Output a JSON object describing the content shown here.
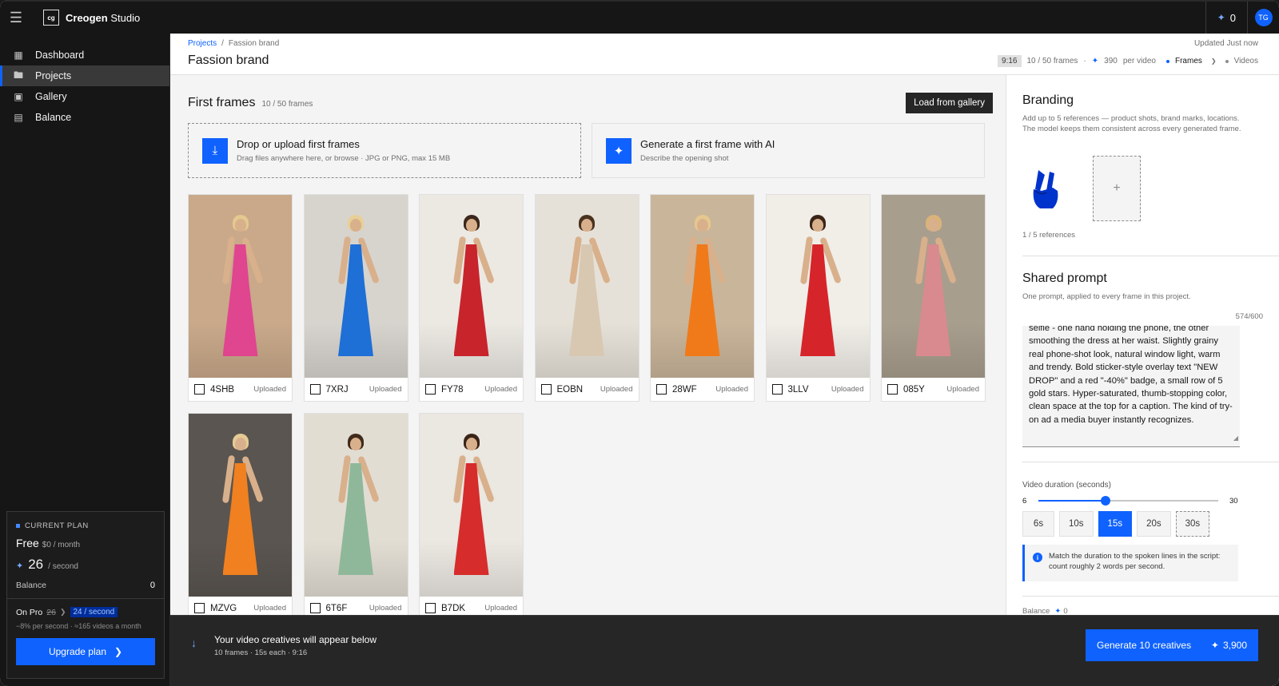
{
  "app": {
    "logo_text": "cg",
    "name_bold": "Creogen",
    "name_rest": "Studio",
    "credits": "0",
    "avatar_initials": "TG"
  },
  "sidebar": {
    "items": [
      {
        "label": "Dashboard",
        "icon": "grid-icon"
      },
      {
        "label": "Projects",
        "icon": "folder-icon",
        "active": true
      },
      {
        "label": "Gallery",
        "icon": "image-icon"
      },
      {
        "label": "Balance",
        "icon": "wallet-icon"
      }
    ],
    "plan": {
      "tag": "CURRENT PLAN",
      "name": "Free",
      "price": "$0 / month",
      "rate_value": "26",
      "rate_unit": "/ second",
      "balance_label": "Balance",
      "balance_value": "0",
      "pro_label": "On Pro",
      "pro_old": "26",
      "pro_new": "24 / second",
      "pro_sub": "−8% per second · ≈165 videos a month",
      "upgrade_label": "Upgrade plan"
    }
  },
  "header": {
    "crumb_root": "Projects",
    "crumb_sep": "/",
    "crumb_current": "Fassion brand",
    "title": "Fassion brand",
    "updated": "Updated Just now",
    "ratio": "9:16",
    "frames": "10 / 50 frames",
    "per_video_value": "390",
    "per_video_label": "per video",
    "step_frames": "Frames",
    "step_videos": "Videos"
  },
  "first_frames": {
    "title": "First frames",
    "count": "10 / 50 frames",
    "load_label": "Load from gallery",
    "upload_title": "Drop or upload first frames",
    "upload_sub": "Drag files anywhere here, or browse · JPG or PNG, max 15 MB",
    "ai_title": "Generate a first frame with AI",
    "ai_sub": "Describe the opening shot",
    "status": "Uploaded",
    "tiles": [
      {
        "id": "4SHB",
        "bg": "#c9a98a",
        "dress": "#e0458f",
        "hair": "#e3c98f"
      },
      {
        "id": "7XRJ",
        "bg": "#d7d4ce",
        "dress": "#1e6fd6",
        "hair": "#e8cf95"
      },
      {
        "id": "FY78",
        "bg": "#ece9e3",
        "dress": "#c8242c",
        "hair": "#3b271b"
      },
      {
        "id": "EOBN",
        "bg": "#e6e1d8",
        "dress": "#d8c8b2",
        "hair": "#4a3220"
      },
      {
        "id": "28WF",
        "bg": "#c9b59a",
        "dress": "#f07a1a",
        "hair": "#e6c88e"
      },
      {
        "id": "3LLV",
        "bg": "#f1eee8",
        "dress": "#d6252a",
        "hair": "#3a2418"
      },
      {
        "id": "085Y",
        "bg": "#a89e8e",
        "dress": "#d98a8f",
        "hair": "#d9b379"
      },
      {
        "id": "MZVG",
        "bg": "#5a5550",
        "dress": "#f08020",
        "hair": "#e6cb95"
      },
      {
        "id": "6T6F",
        "bg": "#e2ddd3",
        "dress": "#8fb89a",
        "hair": "#3f2a1c"
      },
      {
        "id": "B7DK",
        "bg": "#ebe7e1",
        "dress": "#d62c2c",
        "hair": "#3a2418"
      }
    ]
  },
  "branding": {
    "title": "Branding",
    "desc": "Add up to 5 references — product shots, brand marks, locations. The model keeps them consistent across every generated frame.",
    "ref_count": "1 / 5 references",
    "add_symbol": "+"
  },
  "shared_prompt": {
    "title": "Shared prompt",
    "desc": "One prompt, applied to every frame in this project.",
    "counter": "574/600",
    "text": "selfie - one hand holding the phone, the other smoothing the dress at her waist. Slightly grainy real phone-shot look, natural window light, warm and trendy. Bold sticker-style overlay text \"NEW DROP\" and a red \"-40%\" badge, a small row of 5 gold stars. Hyper-saturated, thumb-stopping color, clean space at the top for a caption. The kind of try-on ad a media buyer instantly recognizes."
  },
  "duration": {
    "label": "Video duration (seconds)",
    "min": "6",
    "max": "30",
    "value": 15,
    "options": [
      "6s",
      "10s",
      "15s",
      "20s",
      "30s"
    ],
    "selected": "15s",
    "note": "Match the duration to the spoken lines in the script: count roughly 2 words per second.",
    "balance_label": "Balance",
    "balance_value": "0"
  },
  "bottom": {
    "title": "Your video creatives will appear below",
    "sub": "10 frames · 15s each · 9:16",
    "generate_label": "Generate 10 creatives",
    "cost": "3,900"
  },
  "colors": {
    "accent": "#0f62fe",
    "dark": "#161616",
    "panel": "#f4f4f4"
  }
}
